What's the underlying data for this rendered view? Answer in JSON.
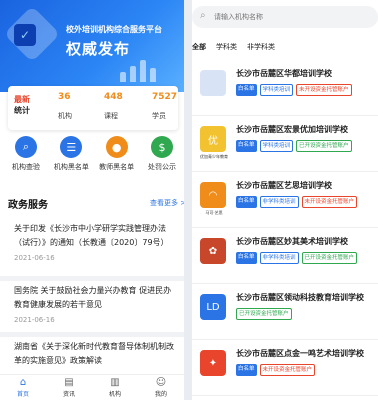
{
  "banner": {
    "small_text": "校外培训机构综合服务平台",
    "big_text": "权威发布"
  },
  "stats": {
    "tag_line1": "最新",
    "tag_line2": "统计",
    "items": [
      {
        "value": "36",
        "label": "机构"
      },
      {
        "value": "448",
        "label": "课程"
      },
      {
        "value": "7527",
        "label": "学员"
      }
    ]
  },
  "quick_links": [
    {
      "label": "机构查验",
      "color": "#2b74e6",
      "icon": "search-icon"
    },
    {
      "label": "机构黑名单",
      "color": "#2b74e6",
      "icon": "list-icon"
    },
    {
      "label": "教师黑名单",
      "color": "#f08c1a",
      "icon": "person-icon"
    },
    {
      "label": "处罚公示",
      "color": "#2fa84f",
      "icon": "dollar-icon"
    }
  ],
  "section": {
    "title": "政务服务",
    "more": "查看更多 >"
  },
  "news": [
    {
      "title": "关于印发《长沙市中小学研学实践管理办法（试行）》的通知（长教通〔2020〕79号）",
      "date": "2021-06-16"
    },
    {
      "title": "国务院 关于鼓励社会力量兴办教育 促进民办教育健康发展的若干意见",
      "date": "2021-06-16"
    },
    {
      "title": "湖南省《关于深化新时代教育督导体制机制改革的实施意见》政策解读",
      "date": ""
    }
  ],
  "tabbar": [
    {
      "label": "首页",
      "icon": "home-icon",
      "active": true
    },
    {
      "label": "资讯",
      "icon": "news-icon",
      "active": false
    },
    {
      "label": "机构",
      "icon": "building-icon",
      "active": false
    },
    {
      "label": "我的",
      "icon": "user-icon",
      "active": false
    }
  ],
  "search": {
    "placeholder": "请输入机构名称"
  },
  "filter_tabs": [
    {
      "label": "全部",
      "active": true
    },
    {
      "label": "学科类",
      "active": false
    },
    {
      "label": "非学科类",
      "active": false
    }
  ],
  "orgs": [
    {
      "name": "长沙市岳麓区华都培训学校",
      "badges": [
        [
          "white",
          "白名单"
        ],
        [
          "cat",
          "学科类培训"
        ],
        [
          "warn",
          "未开设资金托管账户"
        ]
      ],
      "logo_color": "#d8e4f5",
      "logo_caption": ""
    },
    {
      "name": "长沙市岳麓区宏景优加培训学校",
      "badges": [
        [
          "white",
          "白名单"
        ],
        [
          "cat",
          "学科类培训"
        ],
        [
          "ok",
          "已开设资金托管账户"
        ]
      ],
      "logo_color": "#f2c230",
      "logo_caption": "优加青少年教育"
    },
    {
      "name": "长沙市岳麓区艺思培训学校",
      "badges": [
        [
          "white",
          "白名单"
        ],
        [
          "cat",
          "非学科类培训"
        ],
        [
          "warn",
          "未开设资金托管账户"
        ]
      ],
      "logo_color": "#f08c1a",
      "logo_caption": "马可·艺思"
    },
    {
      "name": "长沙市岳麓区妙其美术培训学校",
      "badges": [
        [
          "white",
          "白名单"
        ],
        [
          "cat",
          "非学科类培训"
        ],
        [
          "ok",
          "已开设资金托管账户"
        ]
      ],
      "logo_color": "#c8462a",
      "logo_caption": ""
    },
    {
      "name": "长沙市岳麓区领动科技教育培训学校",
      "badges": [
        [
          "ok",
          "已开设资金托管账户"
        ]
      ],
      "logo_color": "#2b74e6",
      "logo_caption": ""
    },
    {
      "name": "长沙市岳麓区点金一鸣艺术培训学校",
      "badges": [
        [
          "white",
          "白名单"
        ],
        [
          "warn",
          "未开设资金托管账户"
        ]
      ],
      "logo_color": "#e8452c",
      "logo_caption": ""
    }
  ]
}
